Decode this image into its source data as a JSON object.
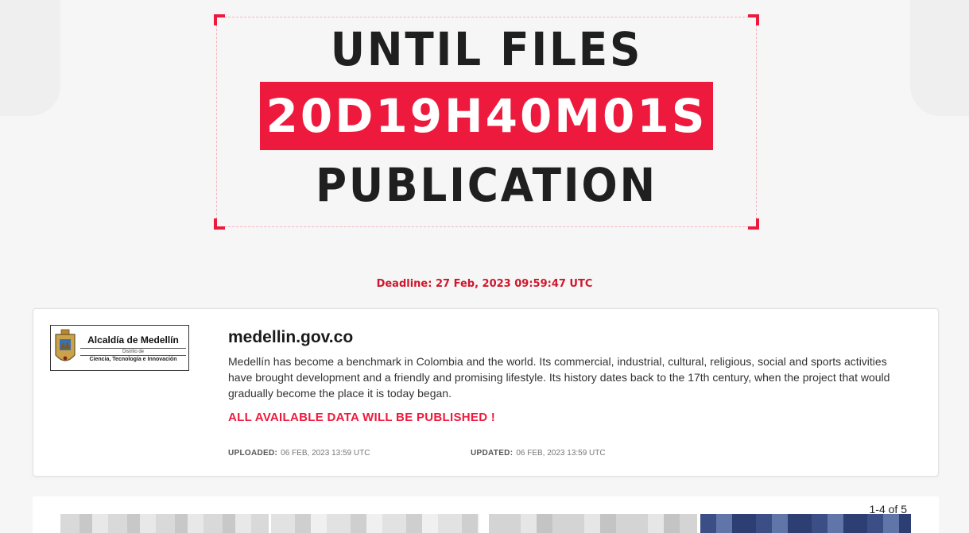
{
  "timer": {
    "line_top": "UNTIL FILES",
    "countdown": "20D19H40M01S",
    "line_bottom": "PUBLICATION"
  },
  "deadline": "Deadline: 27 Feb, 2023 09:59:47 UTC",
  "card": {
    "logo": {
      "name": "Alcaldía de Medellín",
      "sub1": "Distrito de",
      "sub2": "Ciencia, Tecnología e Innovación"
    },
    "title": "medellin.gov.co",
    "description": "Medellín has become a benchmark in Colombia and the world. Its commercial, industrial, cultural, religious, social and sports activities have brought development and a friendly and promising lifestyle. Its history dates back to the 17th century, when the project that would gradually become the place it is today began.",
    "publish_note": "ALL AVAILABLE DATA WILL BE PUBLISHED !",
    "uploaded_label": "UPLOADED:",
    "uploaded_value": "06 FEB, 2023 13:59 UTC",
    "updated_label": "UPDATED:",
    "updated_value": "06 FEB, 2023 13:59 UTC"
  },
  "gallery": {
    "pager": "1-4 of 5"
  },
  "colors": {
    "accent": "#ee1a3d",
    "deadline": "#d0162c",
    "background": "#f6f6f6"
  }
}
